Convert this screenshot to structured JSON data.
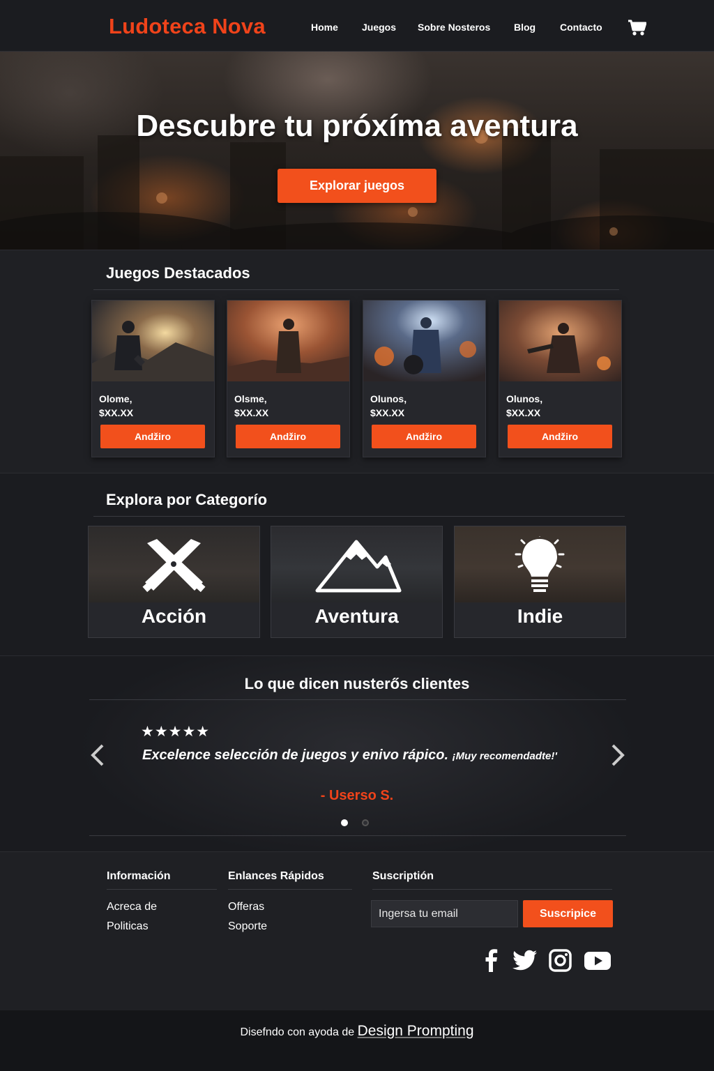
{
  "header": {
    "logo": "Ludoteca Nova",
    "nav": [
      "Home",
      "Juegos",
      "Sobre Nosteros",
      "Blog",
      "Contacto"
    ],
    "cart_icon": "shopping-cart-icon"
  },
  "hero": {
    "title": "Descubre tu próxíma aventura",
    "button": "Explorar juegos"
  },
  "featured": {
    "title": "Juegos Destacados",
    "cards": [
      {
        "name": "Olome,",
        "price": "$XX.XX",
        "button": "Andžiro"
      },
      {
        "name": "Olsme,",
        "price": "$XX.XX",
        "button": "Andžiro"
      },
      {
        "name": "Olunos,",
        "price": "$XX.XX",
        "button": "Andžiro"
      },
      {
        "name": "Olunos,",
        "price": "$XX.XX",
        "button": "Andžiro"
      }
    ]
  },
  "categories": {
    "title": "Explora por Categorío",
    "items": [
      {
        "label": "Acción",
        "icon": "crossed-weapons-icon"
      },
      {
        "label": "Aventura",
        "icon": "mountain-icon"
      },
      {
        "label": "Indie",
        "icon": "lightbulb-icon"
      }
    ]
  },
  "testimonials": {
    "title": "Lo que dicen nusterős clientes",
    "stars": "★★★★★",
    "rating": 5,
    "quote": "Excelence selección de juegos y enivo rápico.",
    "quote_tail": "¡Muy recomendadte!'",
    "author": "- Userso S."
  },
  "footer": {
    "info": {
      "title": "Información",
      "links": [
        "Acreca de",
        "Politicas"
      ]
    },
    "quick": {
      "title": "Enlances Rápidos",
      "links": [
        "Offeras",
        "Soporte"
      ]
    },
    "subscription": {
      "title": "Suscriptión",
      "placeholder": "Ingersa tu email",
      "button": "Suscripice"
    },
    "social": [
      "facebook-icon",
      "twitter-icon",
      "instagram-icon",
      "youtube-icon"
    ],
    "credit_prefix": "Disefndo con ayoda de",
    "credit_brand": "Design Prompting"
  },
  "colors": {
    "accent": "#f2501c",
    "logo": "#f0431a",
    "background": "#18191d"
  }
}
